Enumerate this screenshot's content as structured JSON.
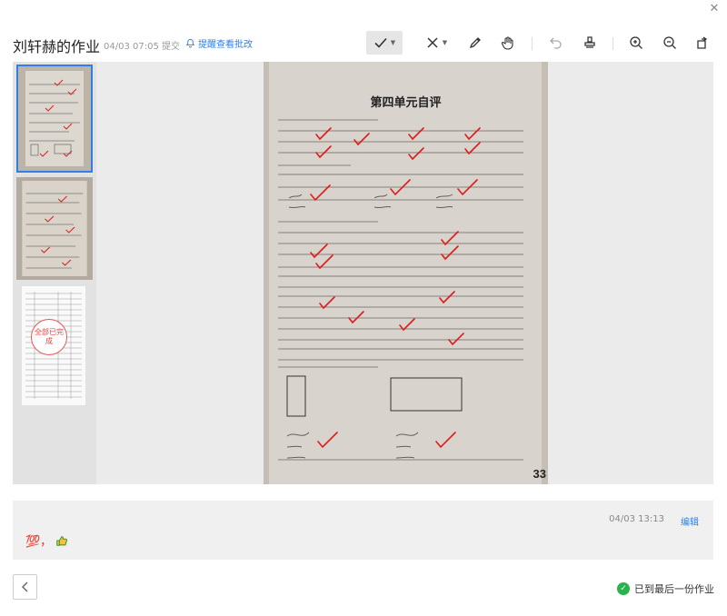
{
  "window": {
    "close_label": "✕"
  },
  "header": {
    "title": "刘轩赫的作业",
    "submit_time": "04/03 07:05 提交",
    "remind_label": "提醒查看批改"
  },
  "toolbar": {
    "tools": [
      "check-tool",
      "cross-tool",
      "pen-tool",
      "hand-tool",
      "undo-tool",
      "stamp-tool",
      "zoom-in-tool",
      "zoom-out-tool",
      "rotate-tool"
    ]
  },
  "thumbnails": {
    "items": [
      {
        "label": "page-1",
        "selected": true
      },
      {
        "label": "page-2",
        "selected": false
      },
      {
        "label": "page-3",
        "selected": false,
        "stamp": "全部已完成"
      }
    ]
  },
  "worksheet": {
    "title": "第四单元自评",
    "page_number": "33"
  },
  "comment": {
    "time": "04/03 13:13",
    "edit_label": "编辑",
    "content": "💯，"
  },
  "footer": {
    "status": "已到最后一份作业"
  }
}
